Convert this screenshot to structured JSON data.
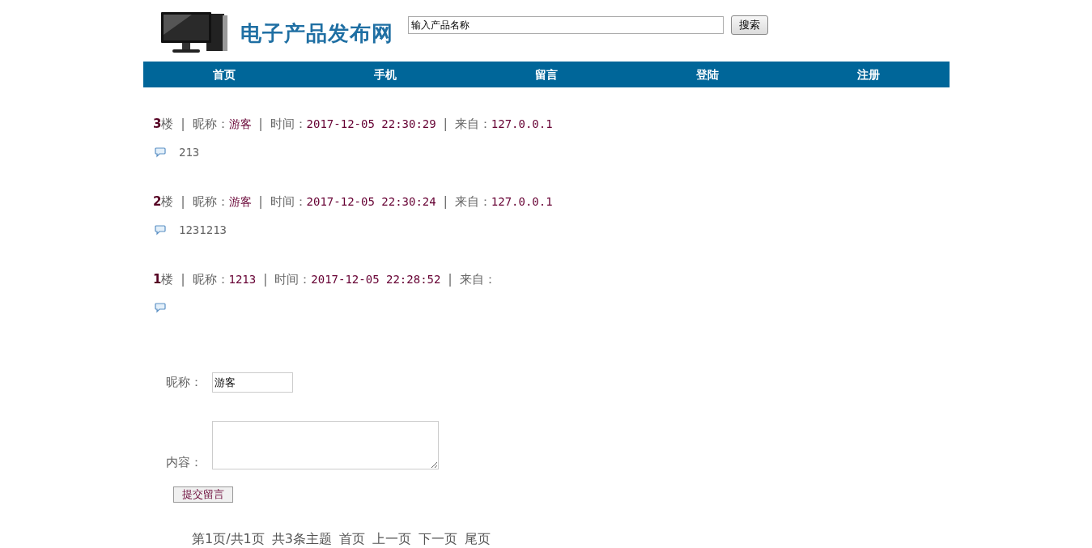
{
  "header": {
    "site_title": "电子产品发布网",
    "search": {
      "value": "输入产品名称"
    },
    "search_button": "搜索"
  },
  "nav": [
    {
      "label": "首页"
    },
    {
      "label": "手机"
    },
    {
      "label": "留言"
    },
    {
      "label": "登陆"
    },
    {
      "label": "注册"
    }
  ],
  "posts": [
    {
      "header": [
        {
          "kind": "number",
          "text": "3"
        },
        {
          "kind": "label",
          "text": "楼"
        },
        {
          "kind": "separator",
          "text": "|"
        },
        {
          "kind": "label",
          "text": "昵称："
        },
        {
          "kind": "value",
          "text": "游客"
        },
        {
          "kind": "separator",
          "text": "|"
        },
        {
          "kind": "label",
          "text": "时间："
        },
        {
          "kind": "value",
          "text": "2017-12-05 22:30:29"
        },
        {
          "kind": "separator",
          "text": "|"
        },
        {
          "kind": "label",
          "text": "来自："
        },
        {
          "kind": "value",
          "text": "127.0.0.1"
        }
      ],
      "content": "213"
    },
    {
      "header": [
        {
          "kind": "number",
          "text": "2"
        },
        {
          "kind": "label",
          "text": "楼"
        },
        {
          "kind": "separator",
          "text": "|"
        },
        {
          "kind": "label",
          "text": "昵称："
        },
        {
          "kind": "value",
          "text": "游客"
        },
        {
          "kind": "separator",
          "text": "|"
        },
        {
          "kind": "label",
          "text": "时间："
        },
        {
          "kind": "value",
          "text": "2017-12-05 22:30:24"
        },
        {
          "kind": "separator",
          "text": "|"
        },
        {
          "kind": "label",
          "text": "来自："
        },
        {
          "kind": "value",
          "text": "127.0.0.1"
        }
      ],
      "content": "1231213"
    },
    {
      "header": [
        {
          "kind": "number",
          "text": "1"
        },
        {
          "kind": "label",
          "text": "楼"
        },
        {
          "kind": "separator",
          "text": "|"
        },
        {
          "kind": "label",
          "text": "昵称："
        },
        {
          "kind": "value",
          "text": "1213"
        },
        {
          "kind": "separator",
          "text": "|"
        },
        {
          "kind": "label",
          "text": "时间："
        },
        {
          "kind": "value",
          "text": "2017-12-05 22:28:52"
        },
        {
          "kind": "separator",
          "text": "|"
        },
        {
          "kind": "label",
          "text": "来自："
        }
      ]
    }
  ],
  "form": {
    "nickname_label": "昵称：",
    "nickname_value": "游客",
    "content_label": "内容：",
    "submit": "提交留言"
  },
  "pagination": [
    "第1页/共1页",
    "共3条主题",
    "首页",
    "上一页",
    "下一页",
    "尾页"
  ]
}
